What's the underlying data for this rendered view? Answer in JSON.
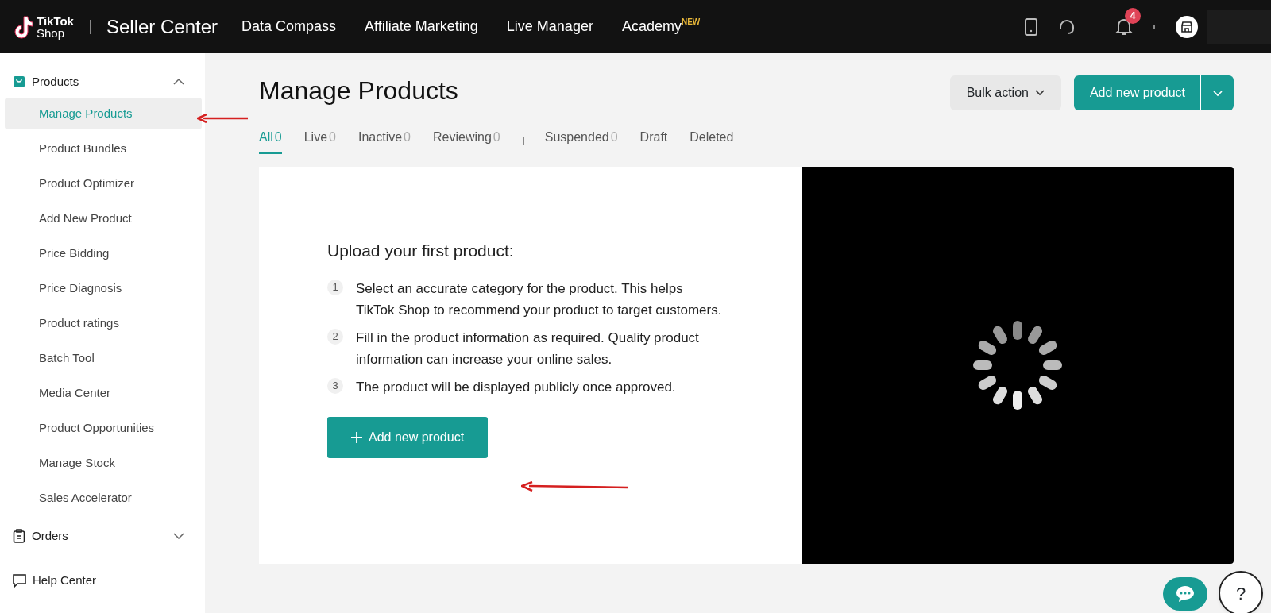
{
  "header": {
    "logo_text": "TikTok",
    "logo_subtext": "Shop",
    "title": "Seller Center",
    "nav": [
      {
        "label": "Data Compass"
      },
      {
        "label": "Affiliate Marketing"
      },
      {
        "label": "Live Manager"
      },
      {
        "label": "Academy",
        "badge": "NEW"
      }
    ],
    "notification_count": "4"
  },
  "sidebar": {
    "groups": [
      {
        "label": "Products",
        "expanded": true,
        "items": [
          {
            "label": "Manage Products",
            "selected": true
          },
          {
            "label": "Product Bundles",
            "selected": false
          },
          {
            "label": "Product Optimizer",
            "selected": false
          },
          {
            "label": "Add New Product",
            "selected": false
          },
          {
            "label": "Price Bidding",
            "selected": false
          },
          {
            "label": "Price Diagnosis",
            "selected": false
          },
          {
            "label": "Product ratings",
            "selected": false
          },
          {
            "label": "Batch Tool",
            "selected": false
          },
          {
            "label": "Media Center",
            "selected": false
          },
          {
            "label": "Product Opportunities",
            "selected": false
          },
          {
            "label": "Manage Stock",
            "selected": false
          },
          {
            "label": "Sales Accelerator",
            "selected": false
          }
        ]
      },
      {
        "label": "Orders",
        "expanded": false
      }
    ],
    "help": "Help Center"
  },
  "page": {
    "title": "Manage Products",
    "bulk_action": "Bulk action",
    "add_button": "Add new product",
    "tabs": [
      {
        "label": "All",
        "count": "0",
        "selected": true
      },
      {
        "label": "Live",
        "count": "0",
        "selected": false
      },
      {
        "label": "Inactive",
        "count": "0",
        "selected": false
      },
      {
        "label": "Reviewing",
        "count": "0",
        "selected": false
      },
      {
        "label": "Suspended",
        "count": "0",
        "selected": false
      },
      {
        "label": "Draft",
        "selected": false
      },
      {
        "label": "Deleted",
        "selected": false
      }
    ],
    "intro": {
      "heading": "Upload your first product:",
      "steps": [
        {
          "number": "1",
          "text": "Select an accurate category for the product. This helps TikTok Shop to recommend your product to target customers."
        },
        {
          "number": "2",
          "text": "Fill in the product information as required. Quality product information can increase your online sales."
        },
        {
          "number": "3",
          "text": "The product will be displayed publicly once approved."
        }
      ],
      "button": "Add new product"
    }
  },
  "floating": {
    "help": "?"
  }
}
